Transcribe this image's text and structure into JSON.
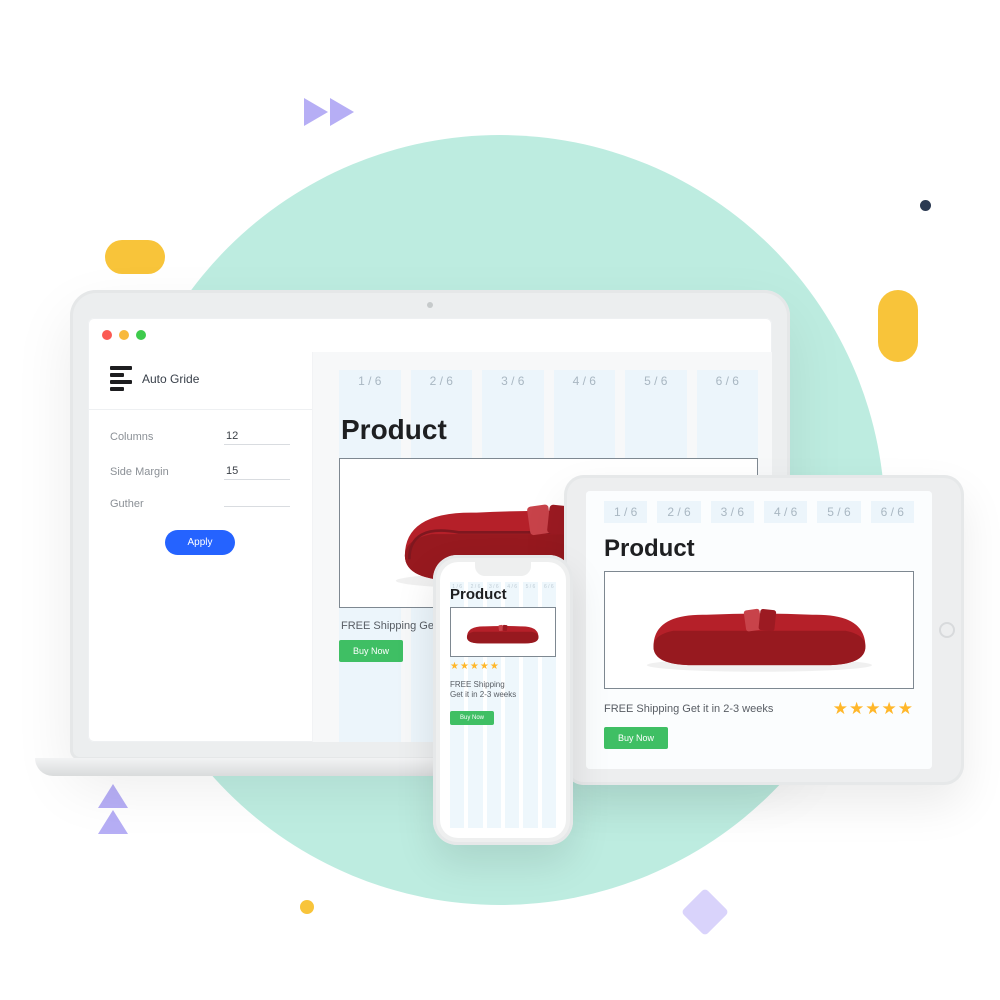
{
  "sidebar": {
    "title": "Auto Gride",
    "fields": {
      "columns_label": "Columns",
      "columns_value": "12",
      "sidemargin_label": "Side Margin",
      "sidemargin_value": "15",
      "gutter_label": "Guther",
      "gutter_value": ""
    },
    "apply_label": "Apply"
  },
  "grid_labels": [
    "1 / 6",
    "2 / 6",
    "3 / 6",
    "4 / 6",
    "5 / 6",
    "6 / 6"
  ],
  "product": {
    "title": "Product",
    "shipping": "FREE Shipping Get it in 2-3 weeks",
    "shipping_line1": "FREE Shipping",
    "shipping_line2": "Get it in 2-3 weeks",
    "buy_label": "Buy Now",
    "stars": "★★★★★"
  },
  "colors": {
    "accent_blue": "#2563ff",
    "accent_green": "#3fbf64",
    "sofa_red": "#b52029",
    "sofa_red_dark": "#7f171f",
    "star": "#ffb72a",
    "mint": "#bdece0"
  }
}
